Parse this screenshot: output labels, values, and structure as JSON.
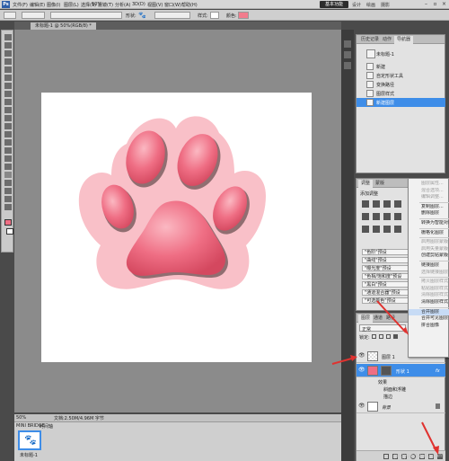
{
  "menubar": {
    "logo": "Ps",
    "items": [
      "文件(F)",
      "编辑(E)",
      "图像(I)",
      "图层(L)",
      "选择(S)",
      "滤镜(T)",
      "分析(A)",
      "3D(D)",
      "视图(V)",
      "窗口(W)",
      "帮助(H)"
    ],
    "zoom": "50%",
    "workspace_active": "基本功能",
    "workspace_links": [
      "设计",
      "绘画",
      "摄影"
    ]
  },
  "optionsbar": {
    "shape_label": "形状:",
    "style_label": "样式:",
    "color_label": "颜色:",
    "color_swatch": "#f27c8d"
  },
  "document": {
    "tab_title": "未标题-1 @ 50%(RGB/8) *",
    "zoom_status": "50%",
    "status_text": "文档:2.50M/4.96M 字节"
  },
  "filmstrip": {
    "tabs": [
      "MINI BRIDGE",
      "时间轴"
    ],
    "thumb_label": "未标题-1"
  },
  "history_panel": {
    "tabs": [
      "历史记录",
      "动作",
      "导航器"
    ],
    "snapshot": "未标题-1",
    "items": [
      "新建",
      "自定形状工具",
      "变换路径",
      "图层样式",
      "新建图层"
    ]
  },
  "adjustments_panel": {
    "tabs": [
      "调整",
      "蒙版"
    ],
    "title": "添加调整",
    "presets": [
      "\"色阶\"预设",
      "\"曲线\"预设",
      "\"曝光度\"预设",
      "\"色相/饱和度\"预设",
      "\"黑白\"预设",
      "\"通道混合器\"预设",
      "\"可选颜色\"预设"
    ]
  },
  "layers_panel": {
    "tabs": [
      "图层",
      "通道",
      "路径"
    ],
    "blend_mode": "正常",
    "opacity_label": "不透明度:",
    "opacity": "100%",
    "lock_label": "锁定:",
    "fill_label": "填充:",
    "fill": "100%",
    "layers": [
      {
        "name": "图层 1",
        "selected": false,
        "fx": false
      },
      {
        "name": "形状 1",
        "selected": true,
        "fx": true
      }
    ],
    "effects_label": "效果",
    "effects": [
      "斜面和浮雕",
      "描边"
    ],
    "background": "背景"
  },
  "context_menu": {
    "items": [
      {
        "label": "图层属性...",
        "enabled": false
      },
      {
        "label": "混合选项...",
        "enabled": false
      },
      {
        "label": "编辑调整...",
        "enabled": false
      },
      {
        "sep": true
      },
      {
        "label": "复制图层...",
        "enabled": true
      },
      {
        "label": "删除图层",
        "enabled": true
      },
      {
        "sep": true
      },
      {
        "label": "转换为智能对象",
        "enabled": true
      },
      {
        "sep": true
      },
      {
        "label": "栅格化图层",
        "enabled": true
      },
      {
        "sep": true
      },
      {
        "label": "启用图层蒙版",
        "enabled": false
      },
      {
        "label": "启用矢量蒙版",
        "enabled": false
      },
      {
        "label": "创建剪贴蒙版",
        "enabled": true
      },
      {
        "sep": true
      },
      {
        "label": "链接图层",
        "enabled": true
      },
      {
        "label": "选择链接图层",
        "enabled": false
      },
      {
        "sep": true
      },
      {
        "label": "拷贝图层样式",
        "enabled": false
      },
      {
        "label": "粘贴图层样式",
        "enabled": false
      },
      {
        "label": "清除图层样式",
        "enabled": false
      },
      {
        "label": "清除图层样式",
        "enabled": true
      },
      {
        "sep": true
      },
      {
        "label": "合并图层",
        "enabled": true,
        "highlight": true
      },
      {
        "label": "合并可见图层",
        "enabled": true
      },
      {
        "label": "拼合图像",
        "enabled": true
      }
    ]
  },
  "watermark": "jingyan.baidu.com",
  "colors": {
    "accent": "#3e8de8",
    "paw_light": "#f9c0c8",
    "paw_pad": "#ef6e84",
    "annotation_arrow": "#e0322f"
  }
}
